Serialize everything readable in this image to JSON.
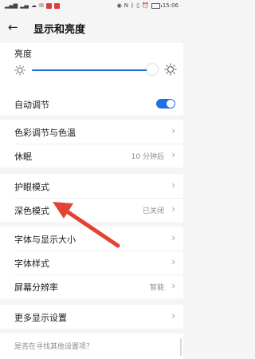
{
  "status_bar": {
    "time": "15:06"
  },
  "header": {
    "title": "显示和亮度"
  },
  "brightness": {
    "label": "亮度",
    "level": 0.98
  },
  "auto_adjust": {
    "label": "自动调节",
    "enabled": true
  },
  "color": {
    "label": "色彩调节与色温"
  },
  "sleep": {
    "label": "休眠",
    "value": "10 分钟后"
  },
  "eye_care": {
    "label": "护眼模式"
  },
  "dark_mode": {
    "label": "深色模式",
    "value": "已关闭"
  },
  "text_size": {
    "label": "字体与显示大小"
  },
  "font_style": {
    "label": "字体样式"
  },
  "resolution": {
    "label": "屏幕分辨率",
    "value": "智能"
  },
  "more": {
    "label": "更多显示设置"
  },
  "suggest": {
    "label": "是否在寻找其他设置项？"
  },
  "colors": {
    "accent": "#1f6fe5",
    "annotation_arrow": "#e24333"
  }
}
